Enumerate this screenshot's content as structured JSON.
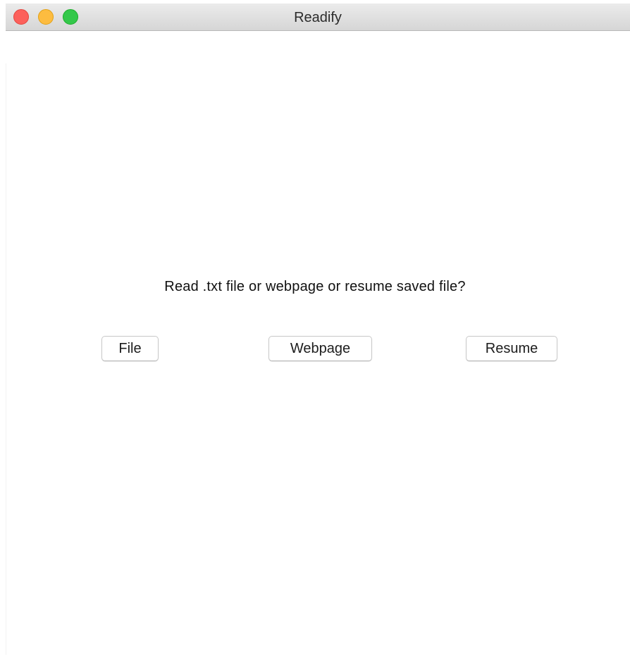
{
  "window": {
    "title": "Readify"
  },
  "dialog": {
    "prompt": "Read .txt file or webpage or resume saved file?",
    "buttons": {
      "file": "File",
      "webpage": "Webpage",
      "resume": "Resume"
    }
  },
  "colors": {
    "close": "#fc605b",
    "minimize": "#fdbc40",
    "zoom": "#34c84a"
  }
}
